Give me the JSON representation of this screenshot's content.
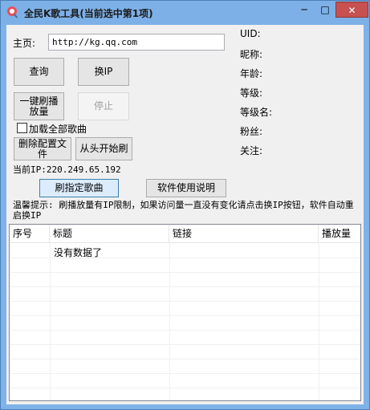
{
  "window": {
    "title": "全民K歌工具(当前选中第1项)",
    "controls": {
      "minimize": "─",
      "maximize": "□",
      "close": "✕"
    }
  },
  "form": {
    "homepage_label": "主页:",
    "homepage_value": "http://kg.qq.com",
    "query_button": "查询",
    "change_ip_button": "换IP",
    "one_click_play_button": "一键刷播放量",
    "stop_button": "停止",
    "load_all_songs_label": "加载全部歌曲",
    "load_all_songs_checked": false,
    "delete_config_button": "删除配置文件",
    "restart_button": "从头开始刷",
    "current_ip": "当前IP:220.249.65.192",
    "brush_song_button": "刷指定歌曲",
    "help_button": "软件使用说明",
    "tip": "温馨提示: 刷播放量有IP限制，如果访问量一直没有变化请点击换IP按钮，软件自动重启换IP"
  },
  "info": {
    "uid_label": "UID:",
    "nickname_label": "昵称:",
    "age_label": "年龄:",
    "level_label": "等级:",
    "level_name_label": "等级名:",
    "fans_label": "粉丝:",
    "follow_label": "关注:"
  },
  "table": {
    "columns": [
      "序号",
      "标题",
      "链接",
      "播放量"
    ],
    "empty_text": "没有数据了"
  }
}
